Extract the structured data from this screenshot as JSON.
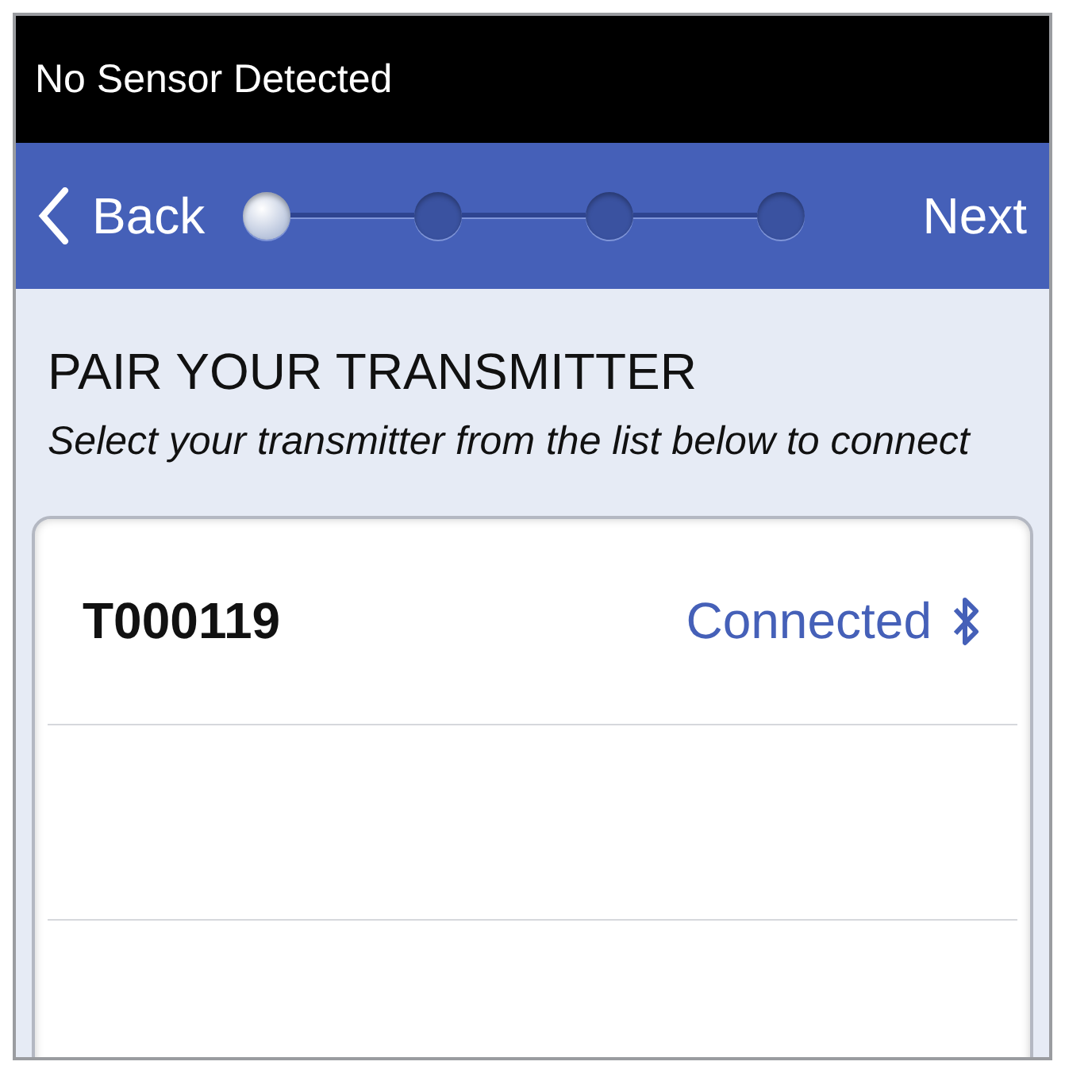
{
  "status_bar": {
    "text": "No Sensor Detected"
  },
  "nav": {
    "back": "Back",
    "next": "Next",
    "steps": [
      {
        "selected": true
      },
      {
        "selected": false
      },
      {
        "selected": false
      },
      {
        "selected": false
      }
    ]
  },
  "heading": "PAIR YOUR TRANSMITTER",
  "instructions": "Select your transmitter from the list below to connect",
  "transmitters": [
    {
      "name": "T000119",
      "status": "Connected",
      "connected": true
    }
  ]
}
